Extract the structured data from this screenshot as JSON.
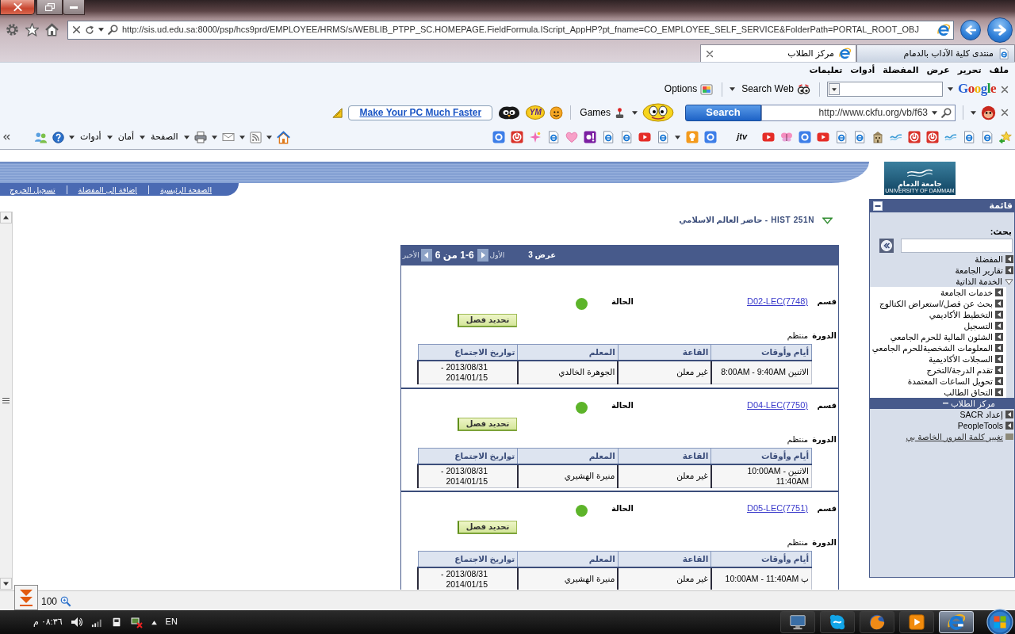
{
  "address_bar": {
    "url": "http://sis.ud.edu.sa:8000/psp/hcs9prd/EMPLOYEE/HRMS/s/WEBLIB_PTPP_SC.HOMEPAGE.FieldFormula.IScript_AppHP?pt_fname=CO_EMPLOYEE_SELF_SERVICE&FolderPath=PORTAL_ROOT_OBJ"
  },
  "tabs": [
    {
      "label": "منتدى كلية الآداب بالدمام",
      "selected": false
    },
    {
      "label": "مركز الطلاب",
      "selected": true
    }
  ],
  "menu_bar": [
    "ملف",
    "تحرير",
    "عرض",
    "المفضلة",
    "أدوات",
    "تعليمات"
  ],
  "google_toolbar": {
    "logo": "Google",
    "search_web": "Search Web",
    "options": "Options"
  },
  "ckfu_toolbar": {
    "search": "Search",
    "url": "http://www.ckfu.org/vb/f63",
    "games": "Games",
    "messenger": "YM",
    "promo": "Make Your PC Much Faster"
  },
  "command_bar": {
    "menus": [
      "الصفحة",
      "أمان",
      "أدوات"
    ],
    "favorite_label": "jtv"
  },
  "header": {
    "links": [
      "الصفحة الرئيسية",
      "إضافة إلى المفضلة",
      "تسجيل الخروج"
    ],
    "logo": {
      "name": "جامعة الدمام",
      "subtitle": "UNIVERSITY OF DAMMAM"
    }
  },
  "course": {
    "title": "HIST 251N - حاضر العالم الاسلامي",
    "expanded": true
  },
  "pager": {
    "show": "عرض 3",
    "first": "الأول",
    "range": "1-6 من 6",
    "last": "الأخير"
  },
  "sections": [
    {
      "section_label": "قسم",
      "section": "D02-LEC(7748)",
      "status": {
        "label": "الحالة",
        "color": "#5db42a"
      },
      "button": "تحديد فصل",
      "session_label": "الدورة",
      "session": "منتظم",
      "columns": [
        "أيام وأوقات",
        "القاعة",
        "المعلم",
        "تواريخ الاجتماع"
      ],
      "rows": [
        [
          "الاثنين 8:00AM - 9:40AM",
          "غير معلن",
          "الجوهرة الخالدي",
          "2013/08/31 - 2014/01/15"
        ]
      ]
    },
    {
      "section_label": "قسم",
      "section": "D04-LEC(7750)",
      "status": {
        "label": "الحالة",
        "color": "#5db42a"
      },
      "button": "تحديد فصل",
      "session_label": "الدورة",
      "session": "منتظم",
      "columns": [
        "أيام وأوقات",
        "القاعة",
        "المعلم",
        "تواريخ الاجتماع"
      ],
      "rows": [
        [
          "الاثنين 10:00AM - 11:40AM",
          "غير معلن",
          "منيرة الهشيري",
          "2013/08/31 - 2014/01/15"
        ]
      ]
    },
    {
      "section_label": "قسم",
      "section": "D05-LEC(7751)",
      "status": {
        "label": "الحالة",
        "color": "#5db42a"
      },
      "button": "تحديد فصل",
      "session_label": "الدورة",
      "session": "منتظم",
      "columns": [
        "أيام وأوقات",
        "القاعة",
        "المعلم",
        "تواريخ الاجتماع"
      ],
      "rows": [
        [
          "ب 10:00AM - 11:40AM",
          "غير معلن",
          "منيرة الهشيري",
          "2013/08/31 - 2014/01/15"
        ]
      ]
    }
  ],
  "sidebar": {
    "title": "قائمة",
    "search_label": "بحث:",
    "items": [
      {
        "label": "المفضلة",
        "kind": "folder",
        "expanded": false,
        "selected": false
      },
      {
        "label": "تقارير الجامعة",
        "kind": "folder",
        "expanded": false,
        "selected": false
      },
      {
        "label": "الخدمة الذاتية",
        "kind": "folder",
        "expanded": true,
        "selected": false,
        "children": [
          {
            "label": "خدمات الجامعة",
            "kind": "folder",
            "expanded": false,
            "selected": false
          },
          {
            "label": "بحث عن فصل/استعراض الكتالوج",
            "kind": "folder",
            "expanded": false,
            "selected": false
          },
          {
            "label": "التخطيط الأكاديمي",
            "kind": "folder",
            "expanded": false,
            "selected": false
          },
          {
            "label": "التسجيل",
            "kind": "folder",
            "expanded": false,
            "selected": false
          },
          {
            "label": "الشئون المالية للحرم الجامعي",
            "kind": "folder",
            "expanded": false,
            "selected": false
          },
          {
            "label": "المعلومات الشخصيةللحرم الجامعي",
            "kind": "folder",
            "expanded": false,
            "selected": false
          },
          {
            "label": "السجلات الأكاديمية",
            "kind": "folder",
            "expanded": false,
            "selected": false
          },
          {
            "label": "تقدم الدرجة/التخرج",
            "kind": "folder",
            "expanded": false,
            "selected": false
          },
          {
            "label": "تحويل الساعات المعتمدة",
            "kind": "folder",
            "expanded": false,
            "selected": false
          },
          {
            "label": "التحاق الطالب",
            "kind": "folder",
            "expanded": false,
            "selected": false
          },
          {
            "label": "مركز الطلاب",
            "kind": "page",
            "selected": true
          }
        ]
      },
      {
        "label": "إعداد SACR",
        "kind": "folder",
        "expanded": false,
        "selected": false
      },
      {
        "label": "PeopleTools",
        "kind": "folder",
        "expanded": false,
        "selected": false
      },
      {
        "label": "تغيير كلمة المرور الخاصة بي",
        "kind": "link",
        "selected": false
      }
    ]
  },
  "status_bar": {
    "zoom": "100"
  },
  "taskbar": {
    "apps": [
      {
        "kind": "browser",
        "selected": true
      },
      {
        "kind": "media",
        "selected": false
      },
      {
        "kind": "fox",
        "selected": false
      },
      {
        "kind": "chat",
        "selected": false
      },
      {
        "kind": "computer",
        "selected": false
      }
    ],
    "language": "EN",
    "clock": "٠٨:٣٦ م"
  }
}
